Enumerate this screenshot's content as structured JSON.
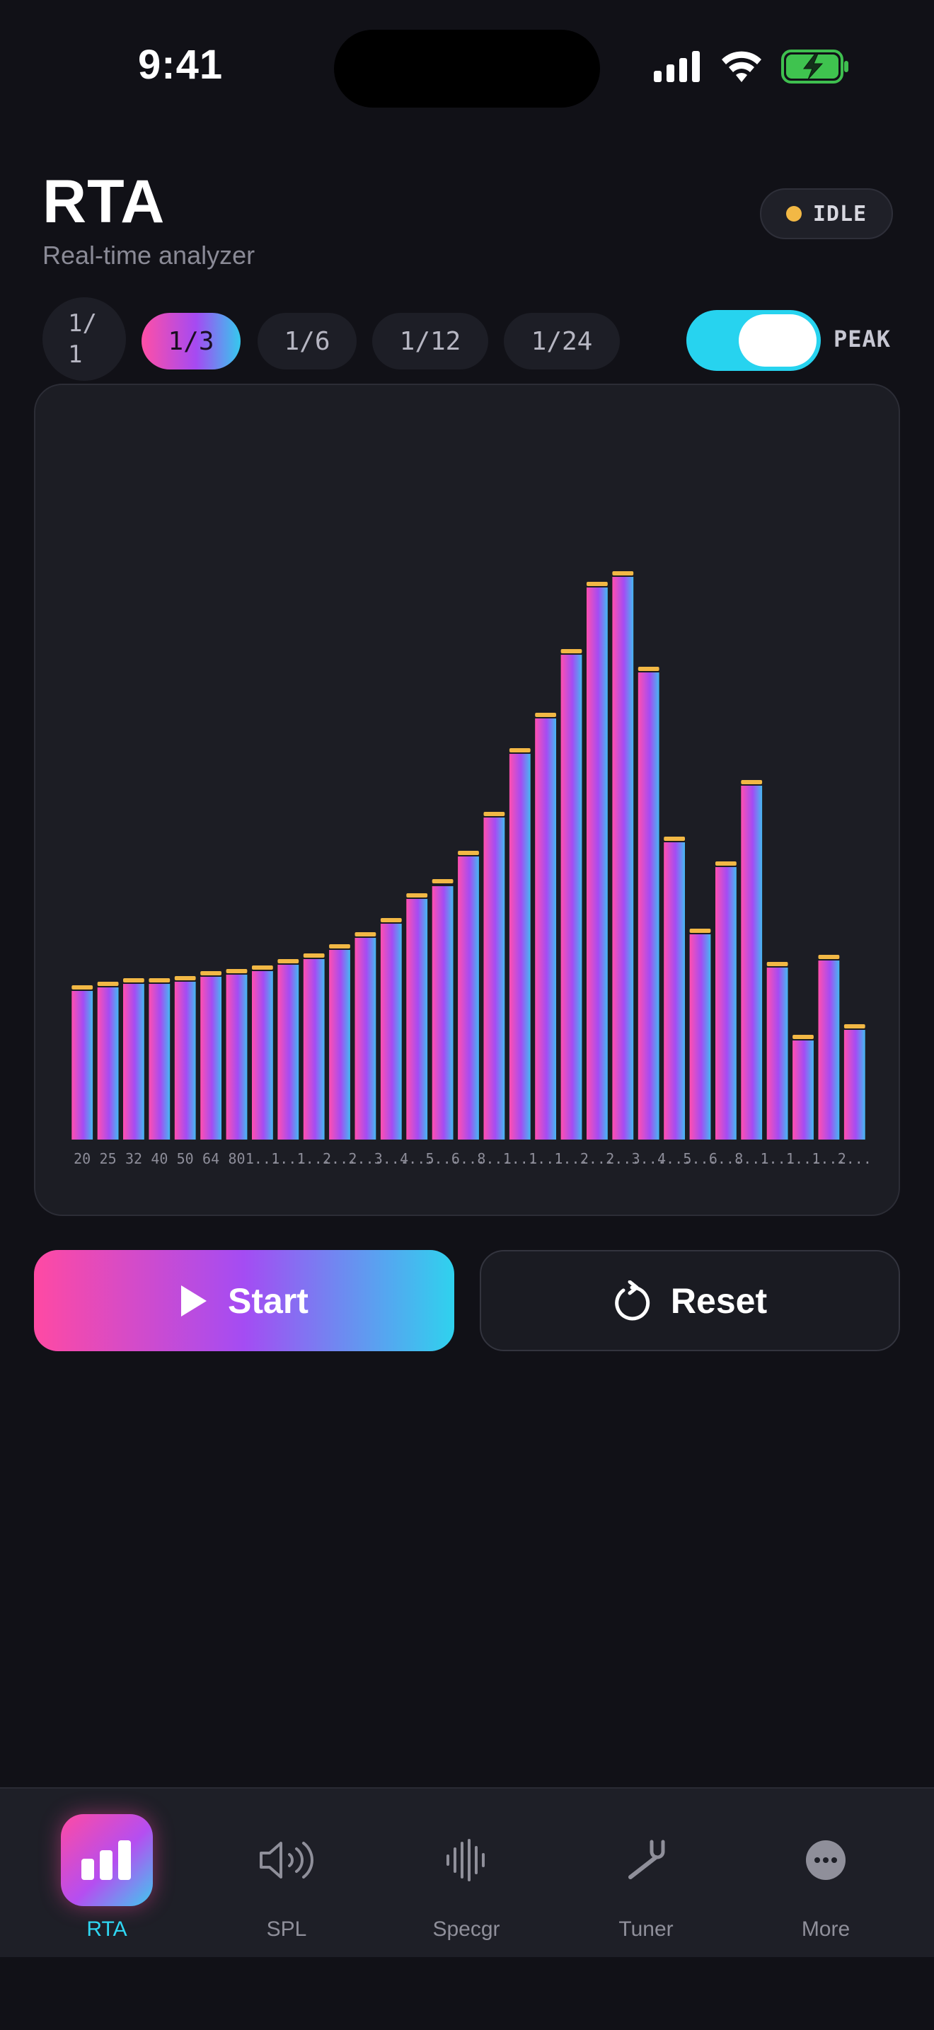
{
  "status": {
    "time": "9:41"
  },
  "header": {
    "title": "RTA",
    "subtitle": "Real-time analyzer",
    "state_badge": "IDLE"
  },
  "resolution": {
    "options": [
      "1/\n1",
      "1/3",
      "1/6",
      "1/12",
      "1/24"
    ],
    "selected": "1/3",
    "peak_label": "PEAK",
    "peak_hold_enabled": true
  },
  "chart_data": {
    "type": "bar",
    "categories": [
      "20",
      "25",
      "32",
      "40",
      "50",
      "64",
      "80",
      "1...",
      "1...",
      "1...",
      "2...",
      "2...",
      "3...",
      "4...",
      "5...",
      "6...",
      "8...",
      "1...",
      "1...",
      "1...",
      "2...",
      "2...",
      "3...",
      "4...",
      "5...",
      "6...",
      "8...",
      "1...",
      "1...",
      "1...",
      "2..."
    ],
    "values": [
      0.21,
      0.215,
      0.22,
      0.22,
      0.223,
      0.23,
      0.233,
      0.238,
      0.247,
      0.255,
      0.268,
      0.285,
      0.305,
      0.34,
      0.358,
      0.4,
      0.455,
      0.545,
      0.595,
      0.685,
      0.78,
      0.795,
      0.66,
      0.42,
      0.29,
      0.385,
      0.5,
      0.243,
      0.14,
      0.253,
      0.155
    ],
    "peaks": [
      0.215,
      0.22,
      0.225,
      0.225,
      0.228,
      0.235,
      0.238,
      0.243,
      0.252,
      0.26,
      0.273,
      0.29,
      0.31,
      0.345,
      0.365,
      0.405,
      0.46,
      0.55,
      0.6,
      0.69,
      0.785,
      0.8,
      0.665,
      0.425,
      0.295,
      0.39,
      0.505,
      0.248,
      0.145,
      0.258,
      0.16
    ],
    "ylim": [
      0,
      1
    ],
    "bar_gradient": [
      "#ff4fb0",
      "#a44cf3",
      "#45b8f2"
    ],
    "peak_color": "#f2b845"
  },
  "actions": {
    "start_label": "Start",
    "reset_label": "Reset"
  },
  "tabs": [
    {
      "label": "RTA",
      "icon": "bar-chart-icon",
      "active": true
    },
    {
      "label": "SPL",
      "icon": "speaker-icon",
      "active": false
    },
    {
      "label": "Specgr",
      "icon": "waveform-icon",
      "active": false
    },
    {
      "label": "Tuner",
      "icon": "tuning-fork-icon",
      "active": false
    },
    {
      "label": "More",
      "icon": "more-icon",
      "active": false
    }
  ]
}
